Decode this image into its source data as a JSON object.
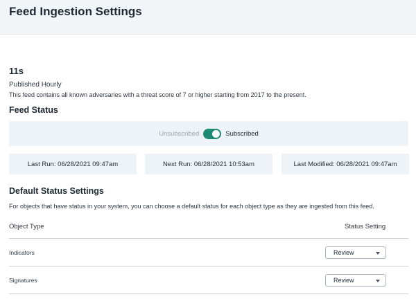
{
  "header": {
    "title": "Feed Ingestion Settings"
  },
  "feed": {
    "name": "11s",
    "frequency": "Published Hourly",
    "description": "This feed contains all known adversaries with a threat score of 7 or higher starting from 2017 to the present."
  },
  "feed_status": {
    "title": "Feed Status",
    "unsubscribed_label": "Unsubscribed",
    "subscribed_label": "Subscribed",
    "subscribed": true,
    "toggle_color": "#1e8a73",
    "last_run": "Last Run: 06/28/2021 09:47am",
    "next_run": "Next Run: 06/28/2021 10:53am",
    "last_modified": "Last Modified: 06/28/2021 09:47am"
  },
  "default_status": {
    "title": "Default Status Settings",
    "helper": "For objects that have status in your system, you can choose a default status for each object type as they are ingested from this feed.",
    "columns": {
      "object_type": "Object Type",
      "status_setting": "Status Setting"
    },
    "rows": [
      {
        "label": "Indicators",
        "value": "Review"
      },
      {
        "label": "Signatures",
        "value": "Review"
      }
    ]
  }
}
